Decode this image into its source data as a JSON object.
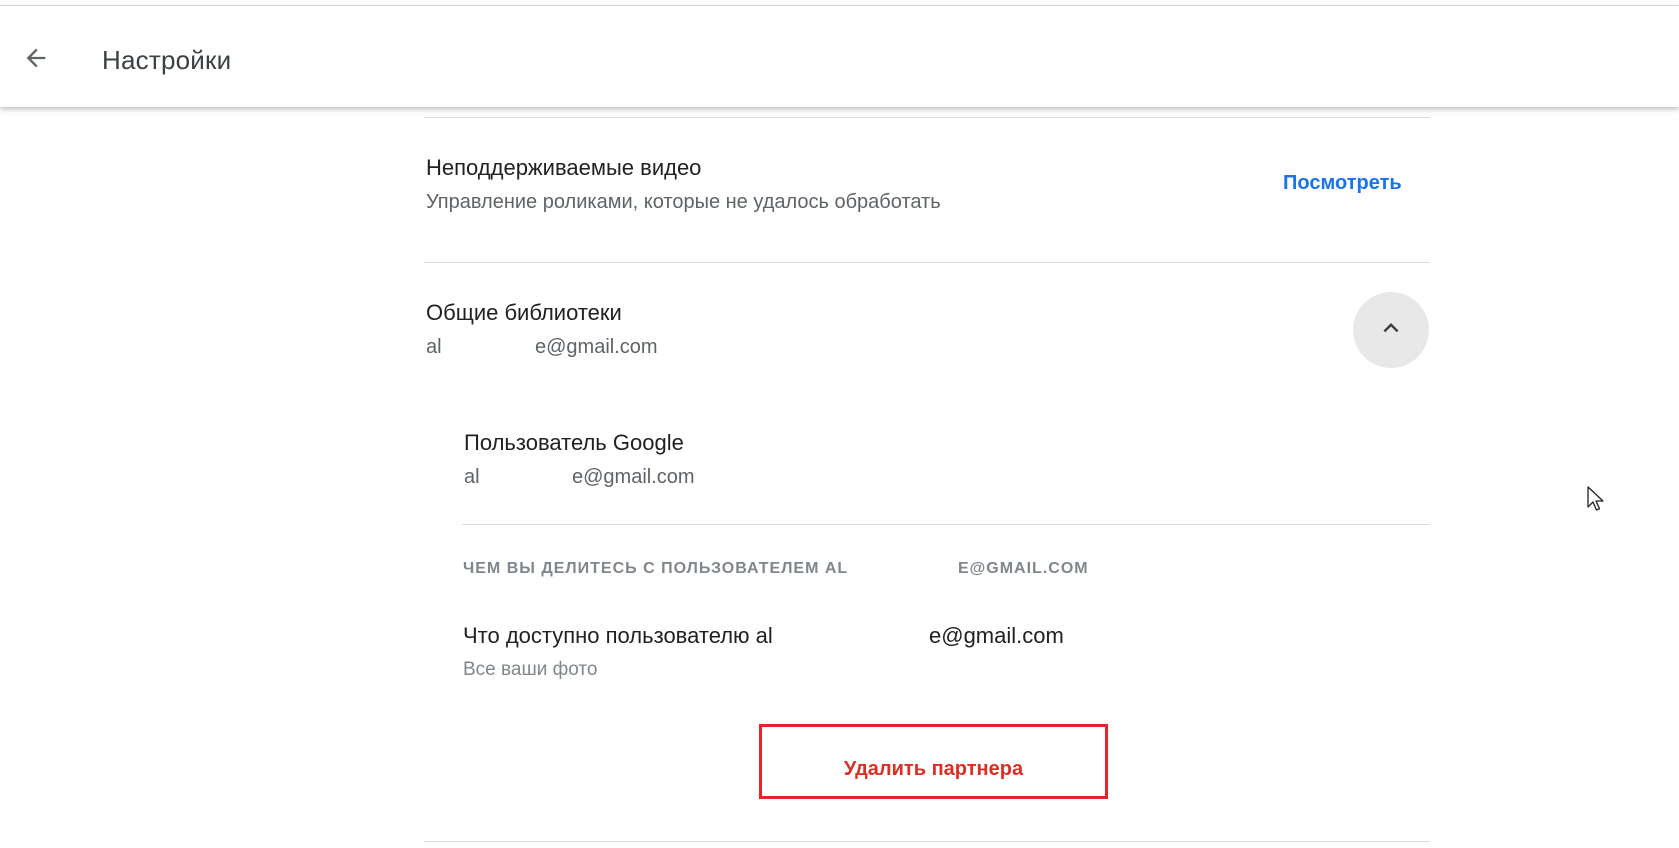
{
  "header": {
    "title": "Настройки"
  },
  "unsupported_videos": {
    "title": "Неподдерживаемые видео",
    "subtitle": "Управление роликами, которые не удалось обработать",
    "action_label": "Посмотреть"
  },
  "shared_libraries": {
    "title": "Общие библиотеки",
    "email_prefix": "al",
    "email_suffix": "e@gmail.com"
  },
  "partner": {
    "title": "Пользователь Google",
    "email_prefix": "al",
    "email_suffix": "e@gmail.com",
    "sharing_caption_prefix": "ЧЕМ ВЫ ДЕЛИТЕСЬ С ПОЛЬЗОВАТЕЛЕМ AL",
    "sharing_caption_suffix": "E@GMAIL.COM",
    "access_title_prefix": "Что доступно пользователю al",
    "access_title_suffix": "e@gmail.com",
    "access_value": "Все ваши фото",
    "remove_label": "Удалить партнера"
  },
  "icons": {
    "back": "arrow-back-icon",
    "collapse": "chevron-up-icon",
    "cursor": "mouse-pointer-icon"
  },
  "colors": {
    "link": "#1a73e8",
    "danger": "#d93025",
    "highlight_border": "#e8242a"
  }
}
